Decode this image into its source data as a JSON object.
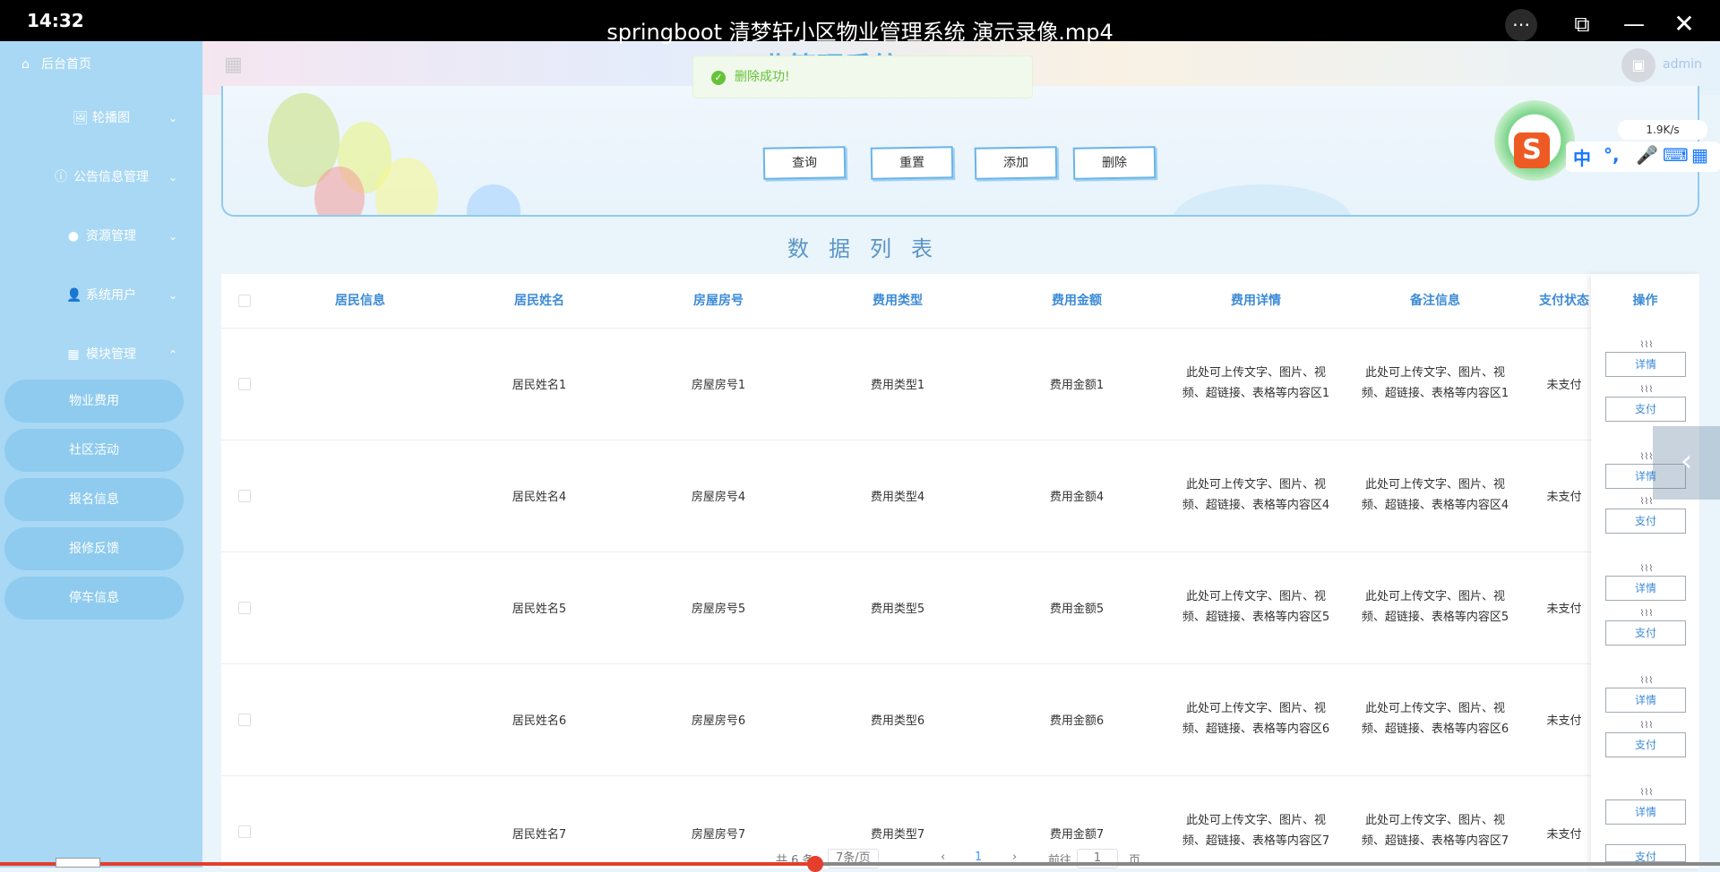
{
  "player": {
    "clock": "14:32",
    "title": "springboot 清梦轩小区物业管理系统 演示录像.mp4",
    "more_icon": "⋯",
    "pip_icon": "⧉",
    "min_icon": "—",
    "close_icon": "✕",
    "progress": 0.474
  },
  "sidebar": {
    "home": "后台首页",
    "groups": [
      {
        "label": "轮播图",
        "icon": "🖼"
      },
      {
        "label": "公告信息管理",
        "icon": "ⓘ"
      },
      {
        "label": "资源管理",
        "icon": "●"
      },
      {
        "label": "系统用户",
        "icon": "👤"
      },
      {
        "label": "模块管理",
        "icon": "▦"
      }
    ],
    "sub_items": [
      "物业费用",
      "社区活动",
      "报名信息",
      "报修反馈",
      "停车信息"
    ]
  },
  "header": {
    "system_title": "业管理系统",
    "user": "admin",
    "menu_icon": "▦"
  },
  "toast": {
    "message": "删除成功!",
    "icon": "✓"
  },
  "search": {
    "buttons": [
      "查询",
      "重置",
      "添加",
      "删除"
    ]
  },
  "list_title": "数据列表",
  "table": {
    "columns": [
      "居民信息",
      "居民姓名",
      "房屋房号",
      "费用类型",
      "费用金额",
      "费用详情",
      "备注信息",
      "支付状态",
      "操作"
    ],
    "rows": [
      {
        "name": "居民姓名1",
        "room": "房屋房号1",
        "type": "费用类型1",
        "amount": "费用金额1",
        "detail_a": "此处可上传文字、图片、视",
        "detail_b": "频、超链接、表格等内容区1",
        "remark_a": "此处可上传文字、图片、视",
        "remark_b": "频、超链接、表格等内容区1",
        "status": "未支付"
      },
      {
        "name": "居民姓名4",
        "room": "房屋房号4",
        "type": "费用类型4",
        "amount": "费用金额4",
        "detail_a": "此处可上传文字、图片、视",
        "detail_b": "频、超链接、表格等内容区4",
        "remark_a": "此处可上传文字、图片、视",
        "remark_b": "频、超链接、表格等内容区4",
        "status": "未支付"
      },
      {
        "name": "居民姓名5",
        "room": "房屋房号5",
        "type": "费用类型5",
        "amount": "费用金额5",
        "detail_a": "此处可上传文字、图片、视",
        "detail_b": "频、超链接、表格等内容区5",
        "remark_a": "此处可上传文字、图片、视",
        "remark_b": "频、超链接、表格等内容区5",
        "status": "未支付"
      },
      {
        "name": "居民姓名6",
        "room": "房屋房号6",
        "type": "费用类型6",
        "amount": "费用金额6",
        "detail_a": "此处可上传文字、图片、视",
        "detail_b": "频、超链接、表格等内容区6",
        "remark_a": "此处可上传文字、图片、视",
        "remark_b": "频、超链接、表格等内容区6",
        "status": "未支付"
      },
      {
        "name": "居民姓名7",
        "room": "房屋房号7",
        "type": "费用类型7",
        "amount": "费用金额7",
        "detail_a": "此处可上传文字、图片、视",
        "detail_b": "频、超链接、表格等内容区7",
        "remark_a": "此处可上传文字、图片、视",
        "remark_b": "频、超链接、表格等内容区7",
        "status": "未支付"
      }
    ],
    "actions": [
      "详情",
      "支付"
    ]
  },
  "pager": {
    "total": "共 6 条",
    "page_size": "7条/页",
    "prev": "‹",
    "current": "1",
    "next": "›",
    "goto": "前往",
    "goto_value": "1",
    "page_unit": "页"
  },
  "ime": {
    "logo": "S",
    "speed": "1.9K/s",
    "mode": "中",
    "punct": "°,",
    "mic_icon": "🎤",
    "keyboard_icon": "⌨",
    "apps_icon": "▦"
  },
  "side_arrow_icon": "‹"
}
